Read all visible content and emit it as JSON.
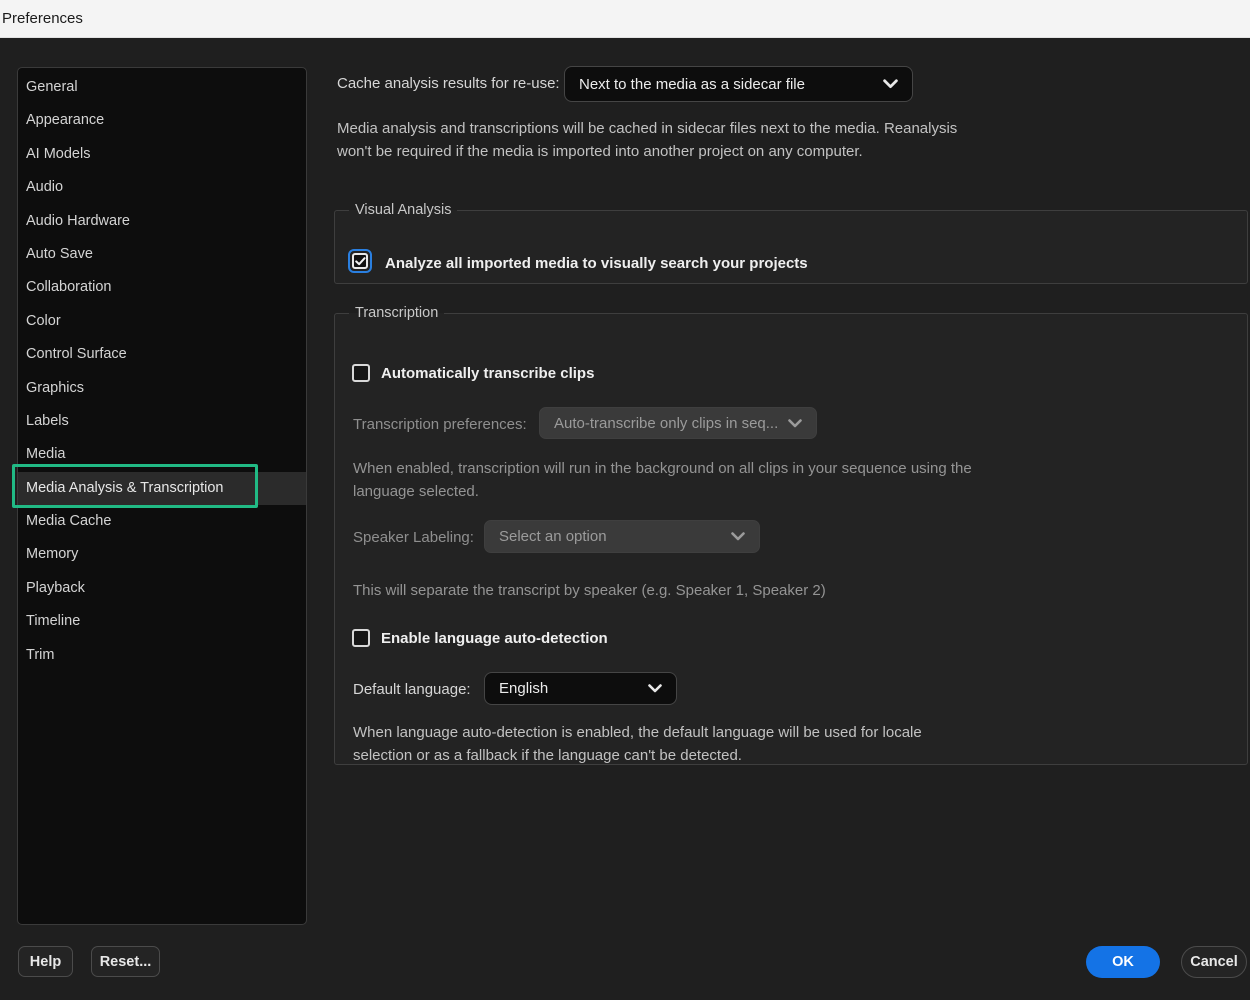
{
  "window": {
    "title": "Preferences"
  },
  "colors": {
    "accent_blue": "#1473e6",
    "focus_ring_blue": "#2a7fe0",
    "annotation_green": "#21ba85",
    "dialog_bg": "#1f1f1f",
    "panel_bg": "#0d0d0d",
    "titlebar_bg": "#f4f4f4"
  },
  "sidebar": {
    "items": [
      {
        "label": "General"
      },
      {
        "label": "Appearance"
      },
      {
        "label": "AI Models"
      },
      {
        "label": "Audio"
      },
      {
        "label": "Audio Hardware"
      },
      {
        "label": "Auto Save"
      },
      {
        "label": "Collaboration"
      },
      {
        "label": "Color"
      },
      {
        "label": "Control Surface"
      },
      {
        "label": "Graphics"
      },
      {
        "label": "Labels"
      },
      {
        "label": "Media"
      },
      {
        "label": "Media Analysis & Transcription"
      },
      {
        "label": "Media Cache"
      },
      {
        "label": "Memory"
      },
      {
        "label": "Playback"
      },
      {
        "label": "Timeline"
      },
      {
        "label": "Trim"
      }
    ],
    "selected": "Media Analysis & Transcription"
  },
  "main": {
    "cache": {
      "label": "Cache analysis results for re-use:",
      "value": "Next to the media as a sidecar file",
      "description": "Media analysis and transcriptions will be cached in sidecar files next to the media. Reanalysis won't be required if the media is imported into another project on any computer."
    },
    "visual_analysis": {
      "legend": "Visual Analysis",
      "analyze_checkbox": {
        "label": "Analyze all imported media to visually search your projects",
        "checked": true
      }
    },
    "transcription": {
      "legend": "Transcription",
      "auto_transcribe_checkbox": {
        "label": "Automatically transcribe clips",
        "checked": false
      },
      "preferences": {
        "label": "Transcription preferences:",
        "value": "Auto-transcribe only clips in seq...",
        "disabled": true
      },
      "preferences_description": "When enabled, transcription will run in the background on all clips in your sequence using the language selected.",
      "speaker_labeling": {
        "label": "Speaker Labeling:",
        "value": "Select an option",
        "disabled": true
      },
      "speaker_description": "This will separate the transcript by speaker (e.g. Speaker 1, Speaker 2)",
      "language_autodetect_checkbox": {
        "label": "Enable language auto-detection",
        "checked": false
      },
      "default_language": {
        "label": "Default language:",
        "value": "English"
      },
      "language_description": "When language auto-detection is enabled, the default language will be used for locale selection or as a fallback if the language can't be detected."
    }
  },
  "footer": {
    "help": "Help",
    "reset": "Reset...",
    "ok": "OK",
    "cancel": "Cancel"
  }
}
